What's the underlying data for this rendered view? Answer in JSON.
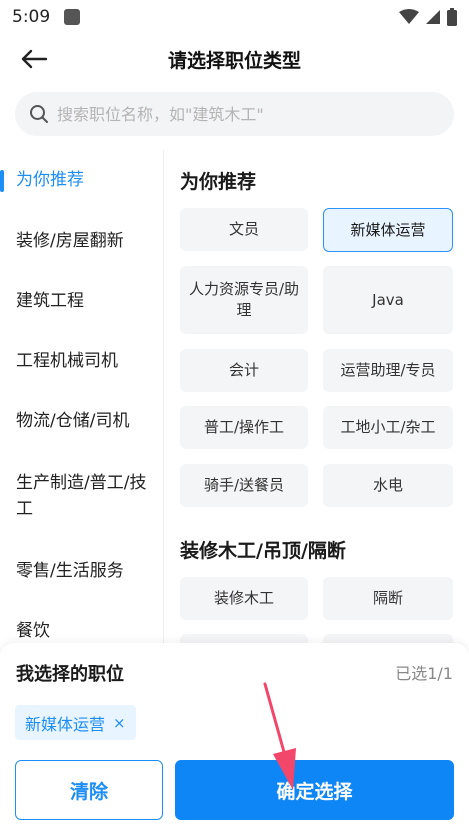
{
  "status_bar": {
    "time": "5:09"
  },
  "header": {
    "title": "请选择职位类型"
  },
  "search": {
    "placeholder": "搜索职位名称，如\"建筑木工\""
  },
  "sidebar": {
    "items": [
      {
        "label": "为你推荐",
        "active": true
      },
      {
        "label": "装修/房屋翻新"
      },
      {
        "label": "建筑工程"
      },
      {
        "label": "工程机械司机"
      },
      {
        "label": "物流/仓储/司机"
      },
      {
        "label": "生产制造/普工/技工"
      },
      {
        "label": "零售/生活服务"
      },
      {
        "label": "餐饮"
      }
    ]
  },
  "main": {
    "sections": [
      {
        "title": "为你推荐",
        "chips": [
          {
            "label": "文员"
          },
          {
            "label": "新媒体运营",
            "selected": true
          },
          {
            "label": "人力资源专员/助理"
          },
          {
            "label": "Java"
          },
          {
            "label": "会计"
          },
          {
            "label": "运营助理/专员"
          },
          {
            "label": "普工/操作工"
          },
          {
            "label": "工地小工/杂工"
          },
          {
            "label": "骑手/送餐员"
          },
          {
            "label": "水电"
          }
        ]
      },
      {
        "title": "装修木工/吊顶/隔断",
        "chips": [
          {
            "label": "装修木工"
          },
          {
            "label": "隔断"
          }
        ]
      }
    ]
  },
  "bottom": {
    "title": "我选择的职位",
    "count": "已选1/1",
    "selected_chip": "新媒体运营",
    "remove_symbol": "×",
    "clear_label": "清除",
    "confirm_label": "确定选择"
  },
  "colors": {
    "accent": "#1d8ef5",
    "confirm_bg": "#0f86f5",
    "chip_bg": "#f4f5f7",
    "selected_bg": "#e8f4ff",
    "annotation_arrow": "#f2466b"
  }
}
